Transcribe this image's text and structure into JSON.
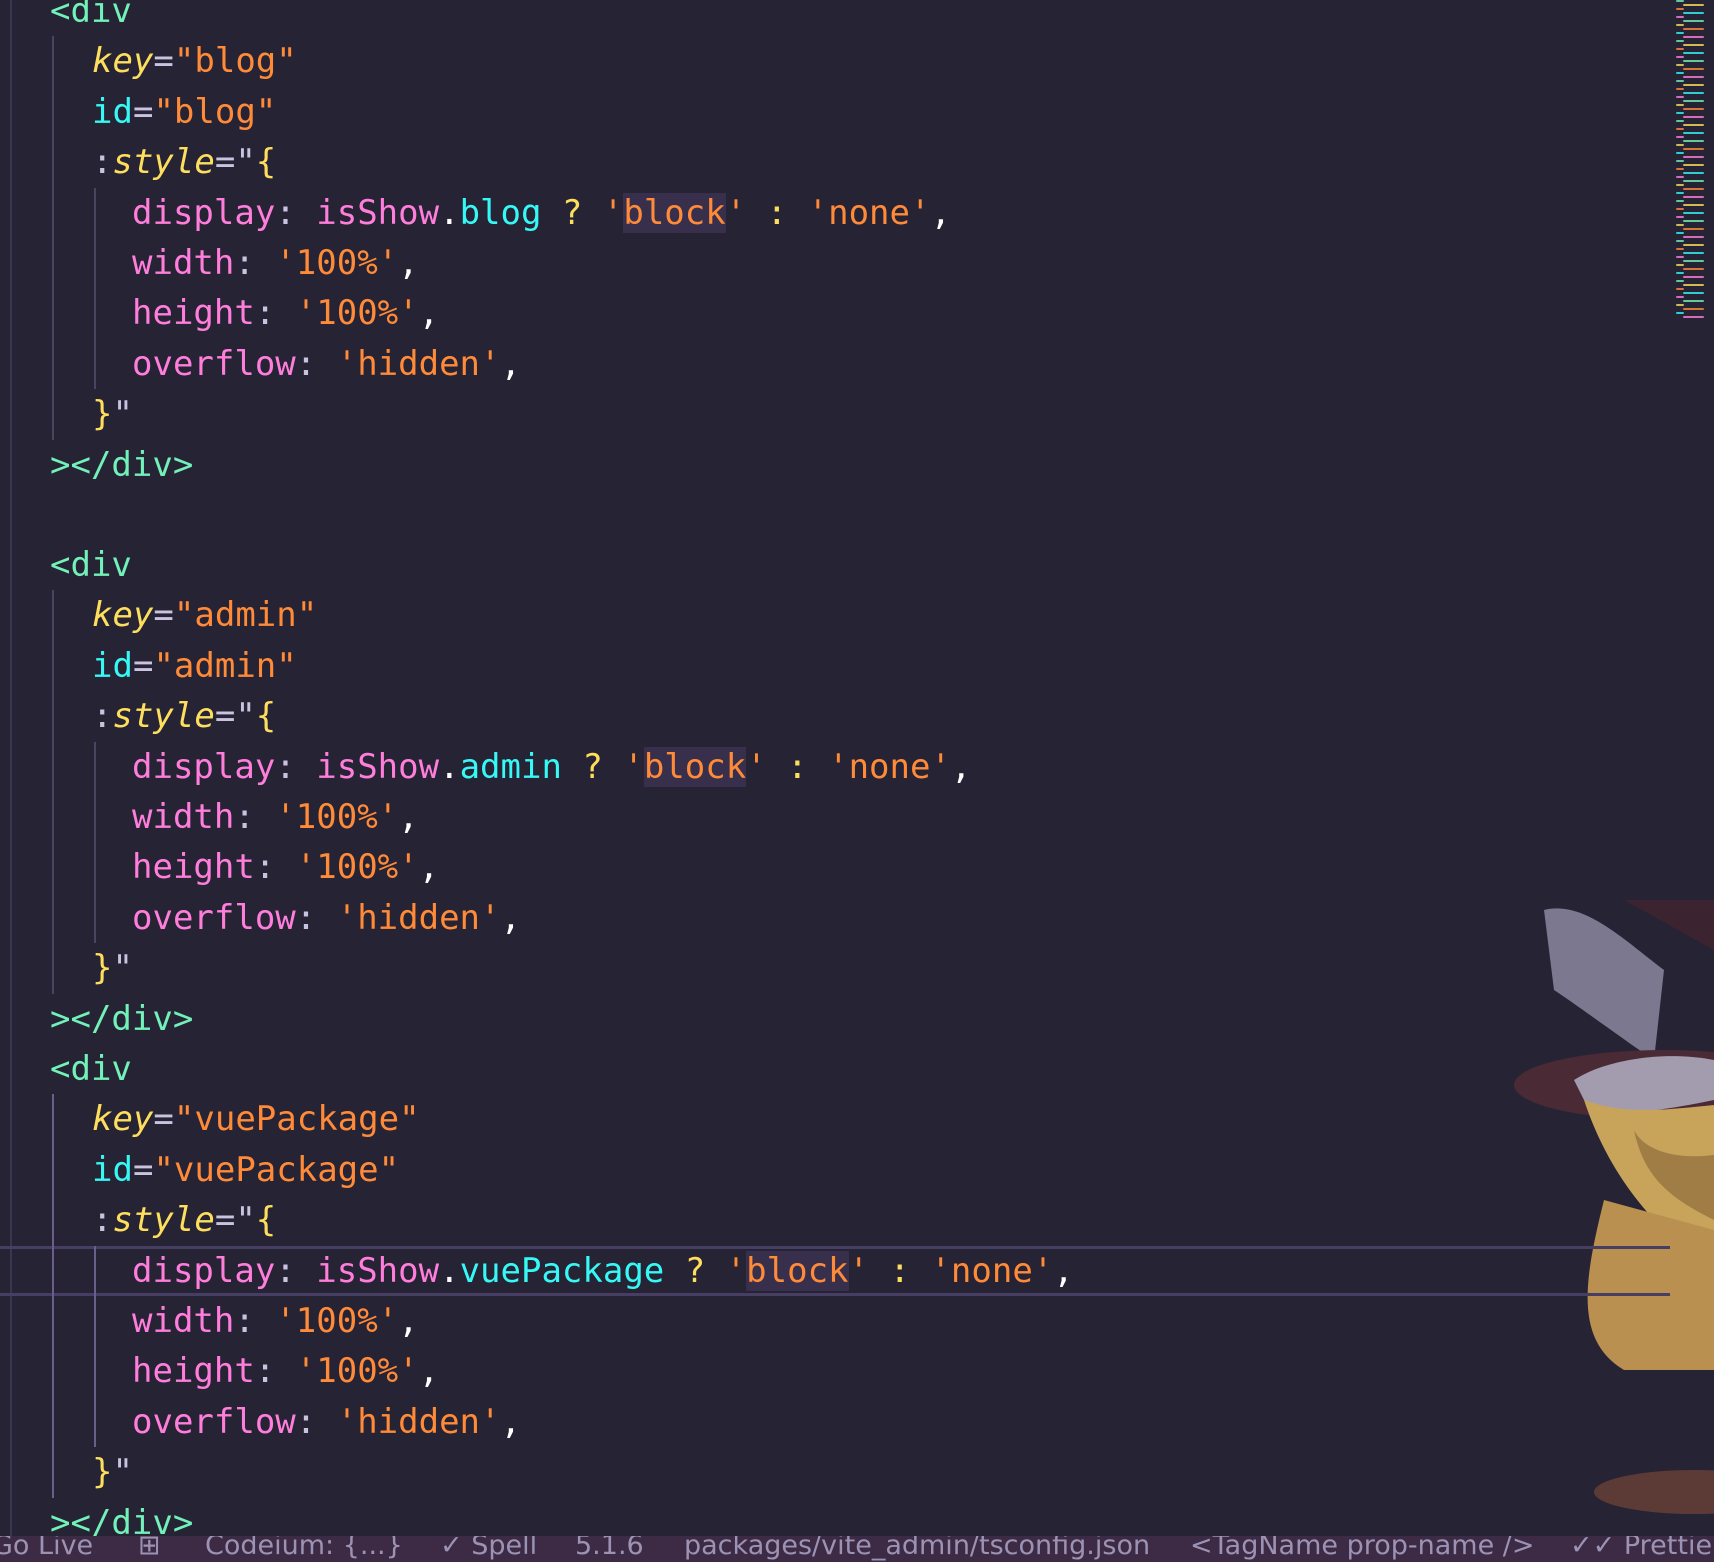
{
  "editor": {
    "blocks": [
      {
        "open_tag": "<div",
        "key_attr": "key",
        "key_value": "\"blog\"",
        "id_attr": "id",
        "id_value": "\"blog\"",
        "style_attr": "style",
        "display_prop": "display",
        "display_object": "isShow",
        "display_member": "blog",
        "block_str": "'block'",
        "none_str": "'none'",
        "width_prop": "width",
        "width_val": "'100%'",
        "height_prop": "height",
        "height_val": "'100%'",
        "overflow_prop": "overflow",
        "overflow_val": "'hidden'",
        "close_brace": "}",
        "close_tag": "></div>"
      },
      {
        "open_tag": "<div",
        "key_attr": "key",
        "key_value": "\"admin\"",
        "id_attr": "id",
        "id_value": "\"admin\"",
        "style_attr": "style",
        "display_prop": "display",
        "display_object": "isShow",
        "display_member": "admin",
        "block_str": "'block'",
        "none_str": "'none'",
        "width_prop": "width",
        "width_val": "'100%'",
        "height_prop": "height",
        "height_val": "'100%'",
        "overflow_prop": "overflow",
        "overflow_val": "'hidden'",
        "close_brace": "}",
        "close_tag": "></div>"
      },
      {
        "open_tag": "<div",
        "key_attr": "key",
        "key_value": "\"vuePackage\"",
        "id_attr": "id",
        "id_value": "\"vuePackage\"",
        "style_attr": "style",
        "display_prop": "display",
        "display_object": "isShow",
        "display_member": "vuePackage",
        "block_str": "'block'",
        "none_str": "'none'",
        "width_prop": "width",
        "width_val": "'100%'",
        "height_prop": "height",
        "height_val": "'100%'",
        "overflow_prop": "overflow",
        "overflow_val": "'hidden'",
        "close_brace": "}",
        "close_tag": "></div>"
      }
    ]
  },
  "statusbar": {
    "items": [
      "Go Live",
      "Codeium: {...}",
      "Spell",
      "5.1.6",
      "packages/vite_admin/tsconfig.json",
      "<TagName prop-name />",
      "Prettier"
    ],
    "icons": [
      "extensions-icon",
      "check-icon",
      "prettier-check-icon"
    ]
  },
  "colors": {
    "background": "#262335",
    "tag": "#72f1b8",
    "string": "#ff8b39",
    "property": "#ff7edb",
    "keyword_yellow": "#fede5d",
    "cyan": "#36f9f6",
    "statusbar": "#3d2b45"
  }
}
